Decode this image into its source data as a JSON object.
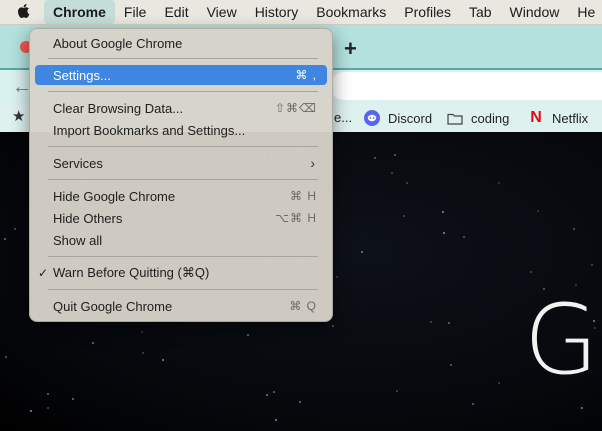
{
  "menubar": {
    "items": [
      "Chrome",
      "File",
      "Edit",
      "View",
      "History",
      "Bookmarks",
      "Profiles",
      "Tab",
      "Window",
      "He"
    ],
    "active_index": 0
  },
  "bookmarks_bar": {
    "items": [
      {
        "label": "e...",
        "icon": "none"
      },
      {
        "label": "Discord",
        "icon": "discord-icon"
      },
      {
        "label": "coding",
        "icon": "folder-icon"
      },
      {
        "label": "Netflix",
        "icon": "netflix-icon"
      }
    ]
  },
  "page": {
    "logo_text": "G"
  },
  "chrome_menu": {
    "items": [
      {
        "label": "About Google Chrome",
        "shortcut": ""
      },
      {
        "label": "Settings...",
        "shortcut": "⌘ ,",
        "highlighted": true
      },
      {
        "label": "Clear Browsing Data...",
        "shortcut": "⇧⌘⌫"
      },
      {
        "label": "Import Bookmarks and Settings...",
        "shortcut": ""
      },
      {
        "label": "Services",
        "shortcut": "",
        "submenu": true
      },
      {
        "label": "Hide Google Chrome",
        "shortcut": "⌘ H"
      },
      {
        "label": "Hide Others",
        "shortcut": "⌥⌘ H"
      },
      {
        "label": "Show all",
        "shortcut": ""
      },
      {
        "label": "Warn Before Quitting (⌘Q)",
        "shortcut": "",
        "checked": true
      },
      {
        "label": "Quit Google Chrome",
        "shortcut": "⌘ Q"
      }
    ]
  },
  "colors": {
    "highlight": "#3f86e0",
    "close_dot": "#ee5a52",
    "tabstrip": "#b3e1dd"
  }
}
